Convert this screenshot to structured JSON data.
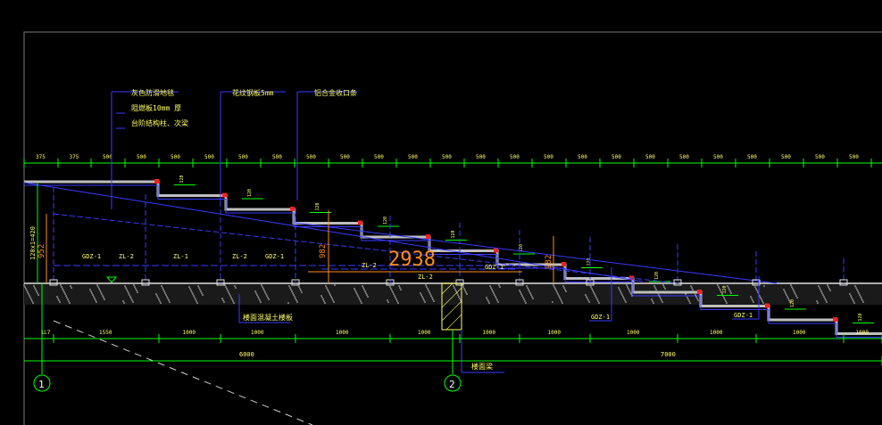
{
  "annotations": {
    "note1": "灰色防滑地毯",
    "note2": "阻燃板10mm 厚",
    "note3": "台阶结构柱、次梁",
    "note4": "花纹钢板5mm",
    "note5": "铝合金收口条",
    "grade_label": "楼面混凝土楼板",
    "beam_label": "楼面梁"
  },
  "dimensions_top": [
    "375",
    "375",
    "500",
    "500",
    "500",
    "500",
    "500",
    "500",
    "500",
    "500",
    "500",
    "500",
    "500",
    "500",
    "500",
    "500",
    "500",
    "500",
    "500",
    "500",
    "500",
    "500",
    "500",
    "500",
    "500"
  ],
  "dimensions_bottom": [
    "1L7",
    "1550",
    "1000",
    "1000",
    "1000",
    "1000",
    "1000",
    "1000",
    "1000",
    "1000",
    "1000",
    "1000",
    "1000"
  ],
  "dimensions_total": [
    "6000",
    "7000"
  ],
  "axes": [
    "1",
    "2"
  ],
  "member_labels": {
    "gdz1_a": "GDZ-1",
    "zl2_a": "ZL-2",
    "zl1_a": "ZL-1",
    "zl2_b": "ZL-2",
    "gdz1_b": "GDZ-1",
    "zl2_c": "ZL-2",
    "zl2_d": "ZL-2",
    "gdz1_c": "GDZ-1",
    "gdz1_d": "GDZ-1",
    "gdz1_e": "GDZ-1",
    "gdz1_f": "GDZ-1"
  },
  "step_heights": [
    "120",
    "120",
    "120",
    "120",
    "120",
    "120",
    "120",
    "120",
    "120",
    "120",
    "120",
    "120",
    "120",
    "120",
    "120",
    "120",
    "120",
    "120",
    "120",
    "120"
  ],
  "elevations": {
    "left_total": "120x1=420",
    "left_h": "952",
    "mid_h": "982",
    "right_h": "982",
    "big_dim": "2938"
  },
  "colors": {
    "background": "#000000",
    "dim_green": "#00ff00",
    "struct_blue": "#3030ff",
    "text_yellow": "#ffff66",
    "slab_white": "#e0e0e0",
    "accent_red": "#ff2020",
    "orange": "#ff8c1a",
    "frame": "#808080"
  }
}
